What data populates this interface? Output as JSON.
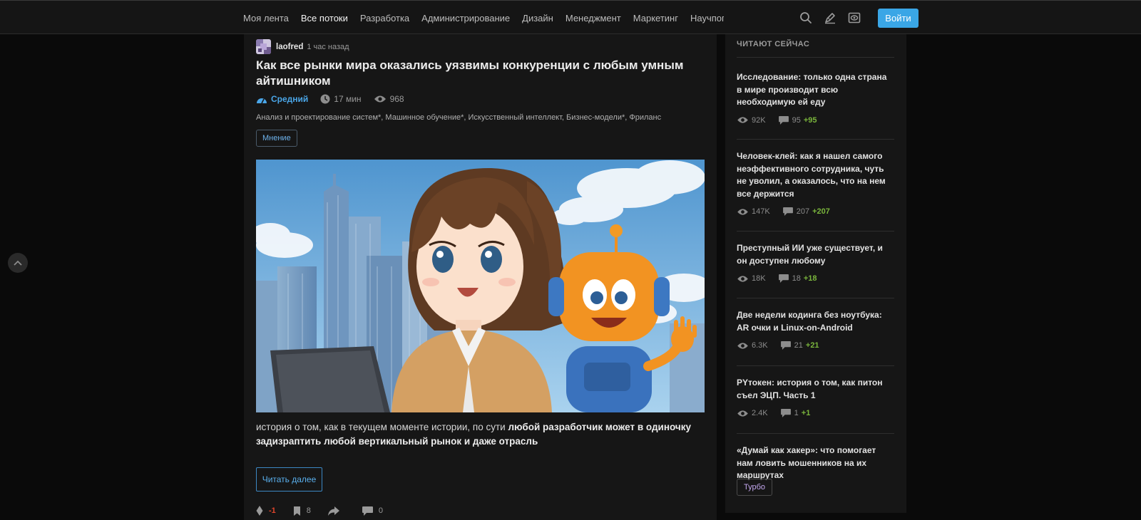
{
  "nav": {
    "items": [
      {
        "label": "Моя лента"
      },
      {
        "label": "Все потоки"
      },
      {
        "label": "Разработка"
      },
      {
        "label": "Администрирование"
      },
      {
        "label": "Дизайн"
      },
      {
        "label": "Менеджмент"
      },
      {
        "label": "Маркетинг"
      },
      {
        "label": "Научпоп"
      }
    ],
    "active_index": 1,
    "login_label": "Войти",
    "accent": "#3aa6e6"
  },
  "article": {
    "author": "laofred",
    "time": "1 час назад",
    "title": "Как все рынки мира оказались уязвимы конкуренции с любым умным айтишником",
    "level": "Средний",
    "read_time": "17 мин",
    "views": "968",
    "hubs": "Анализ и проектирование систем*, Машинное обучение*, Искусственный интеллект, Бизнес-модели*, Фриланс",
    "tag": "Мнение",
    "excerpt_plain": "история о том, как в текущем моменте истории, по сути ",
    "excerpt_bold": "любой разработчик может в одиночку задизраптить любой вертикальный рынок и даже отрасль",
    "read_more": "Читать далее",
    "rating": "-1",
    "bookmarks": "8",
    "comments": "0"
  },
  "sidebar": {
    "heading": "ЧИТАЮТ СЕЙЧАС",
    "items": [
      {
        "title": "Исследование: только одна страна в мире производит всю необходимую ей еду",
        "views": "92K",
        "comments": "95",
        "new": "+95"
      },
      {
        "title": "Человек-клей: как я нашел самого неэффективного сотрудника, чуть не уволил, а оказалось, что на нем все держится",
        "views": "147K",
        "comments": "207",
        "new": "+207"
      },
      {
        "title": "Преступный ИИ уже существует, и он доступен любому",
        "views": "18K",
        "comments": "18",
        "new": "+18"
      },
      {
        "title": "Две недели кодинга без ноутбука: AR очки и Linux-on-Android",
        "views": "6.3K",
        "comments": "21",
        "new": "+21"
      },
      {
        "title": "PYтокен: история о том, как питон съел ЭЦП. Часть 1",
        "views": "2.4K",
        "comments": "1",
        "new": "+1"
      },
      {
        "title": "«Думай как хакер»: что помогает нам ловить мошенников на их маршрутах"
      }
    ],
    "badge": "Турбо"
  }
}
